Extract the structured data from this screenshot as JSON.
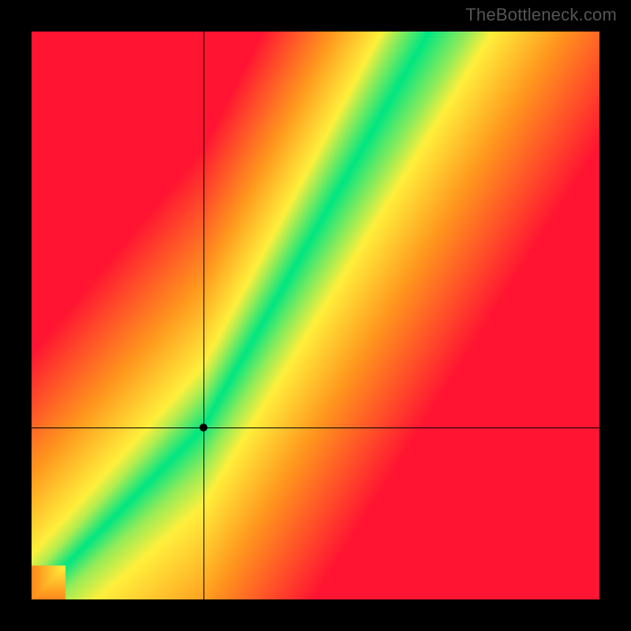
{
  "watermark": "TheBottleneck.com",
  "chart_data": {
    "type": "heatmap",
    "title": "",
    "xlabel": "",
    "ylabel": "",
    "xlim": [
      0,
      1
    ],
    "ylim": [
      0,
      1
    ],
    "colormap_description": "red-orange-yellow-green diagonal optimum band; green at optimal ratio, red away from it",
    "optimum_band": {
      "slope_lower_segment": 1.0,
      "slope_upper_segment": 1.75,
      "knee_x": 0.3
    },
    "crosshair": {
      "x": 0.303,
      "y": 0.303
    },
    "point": {
      "x": 0.303,
      "y": 0.303
    },
    "grid": false
  }
}
